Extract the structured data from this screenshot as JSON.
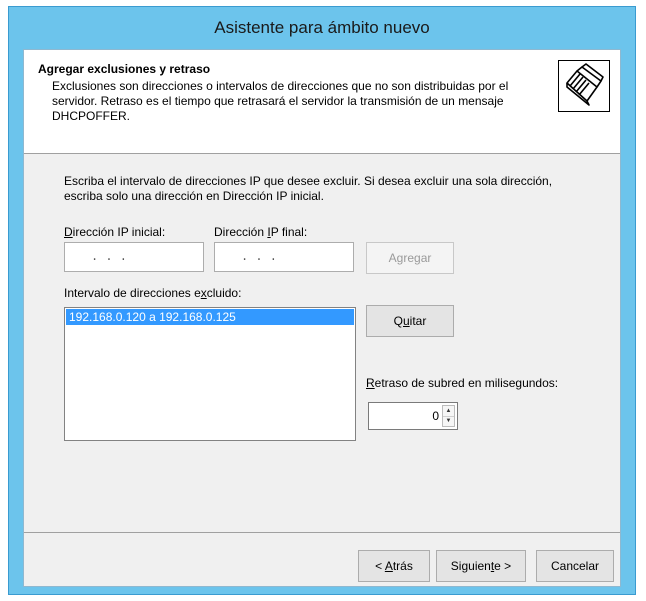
{
  "window": {
    "title": "Asistente para ámbito nuevo"
  },
  "header": {
    "title": "Agregar exclusiones y retraso",
    "description": "Exclusiones son direcciones o intervalos de direcciones que no son distribuidas por el servidor. Retraso es el tiempo que retrasará el servidor la transmisión de un mensaje DHCPOFFER.",
    "icon": "server-wizard-icon"
  },
  "main": {
    "instructions": "Escriba el intervalo de direcciones IP que desee excluir. Si desea excluir una sola dirección, escriba solo una dirección en Dirección IP inicial.",
    "start_ip": {
      "label_pre": "",
      "label_acc": "D",
      "label_post": "irección IP inicial:",
      "value": ".      .      ."
    },
    "end_ip": {
      "label_pre": "Dirección ",
      "label_acc": "I",
      "label_post": "P final:",
      "value": ".      .      ."
    },
    "add_button": {
      "pre": "Agre",
      "acc": "g",
      "post": "ar"
    },
    "excluded_label": {
      "pre": "Intervalo de direcciones e",
      "acc": "x",
      "post": "cluido:"
    },
    "excluded_ranges": [
      "192.168.0.120 a 192.168.0.125"
    ],
    "remove_button": {
      "pre": "Q",
      "acc": "u",
      "post": "itar"
    },
    "delay_label": {
      "pre": "",
      "acc": "R",
      "post": "etraso de subred en milisegundos:"
    },
    "delay_value": "0"
  },
  "footer": {
    "back_button": {
      "pre": "< ",
      "acc": "A",
      "post": "trás"
    },
    "next_button": {
      "pre": "Siguien",
      "acc": "t",
      "post": "e >"
    },
    "cancel_button": "Cancelar"
  },
  "colors": {
    "titlebar": "#6cc4ec",
    "selection": "#3399ff"
  }
}
